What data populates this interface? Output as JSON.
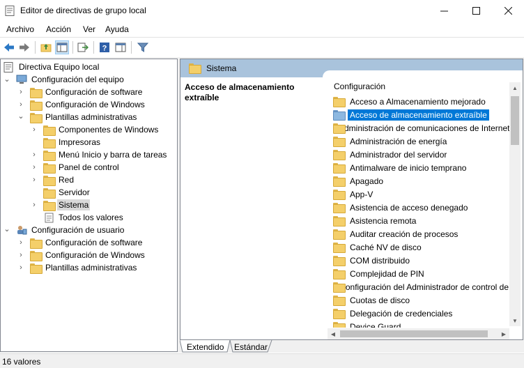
{
  "window": {
    "title": "Editor de directivas de grupo local"
  },
  "menu": [
    "Archivo",
    "Acción",
    "Ver",
    "Ayuda"
  ],
  "tree": {
    "root": "Directiva Equipo local",
    "computer_config": "Configuración del equipo",
    "cc_software": "Configuración de software",
    "cc_windows": "Configuración de Windows",
    "cc_admin": "Plantillas administrativas",
    "admin_components": "Componentes de Windows",
    "admin_printers": "Impresoras",
    "admin_start": "Menú Inicio y barra de tareas",
    "admin_control": "Panel de control",
    "admin_network": "Red",
    "admin_server": "Servidor",
    "admin_system": "Sistema",
    "admin_all": "Todos los valores",
    "user_config": "Configuración de usuario",
    "uc_software": "Configuración de software",
    "uc_windows": "Configuración de Windows",
    "uc_admin": "Plantillas administrativas"
  },
  "header": {
    "title": "Sistema"
  },
  "description": {
    "title": "Acceso de almacenamiento extraíble"
  },
  "list": {
    "column": "Configuración",
    "rows": [
      "Acceso a Almacenamiento mejorado",
      "Acceso de almacenamiento extraíble",
      "Administración de comunicaciones de Internet",
      "Administración de energía",
      "Administrador del servidor",
      "Antimalware de inicio temprano",
      "Apagado",
      "App-V",
      "Asistencia de acceso denegado",
      "Asistencia remota",
      "Auditar creación de procesos",
      "Caché NV de disco",
      "COM distribuido",
      "Complejidad de PIN",
      "Configuración del Administrador de control de",
      "Cuotas de disco",
      "Delegación de credenciales",
      "Device Guard"
    ],
    "selected_index": 1
  },
  "tabs": [
    "Extendido",
    "Estándar"
  ],
  "status": {
    "text": "16 valores"
  }
}
